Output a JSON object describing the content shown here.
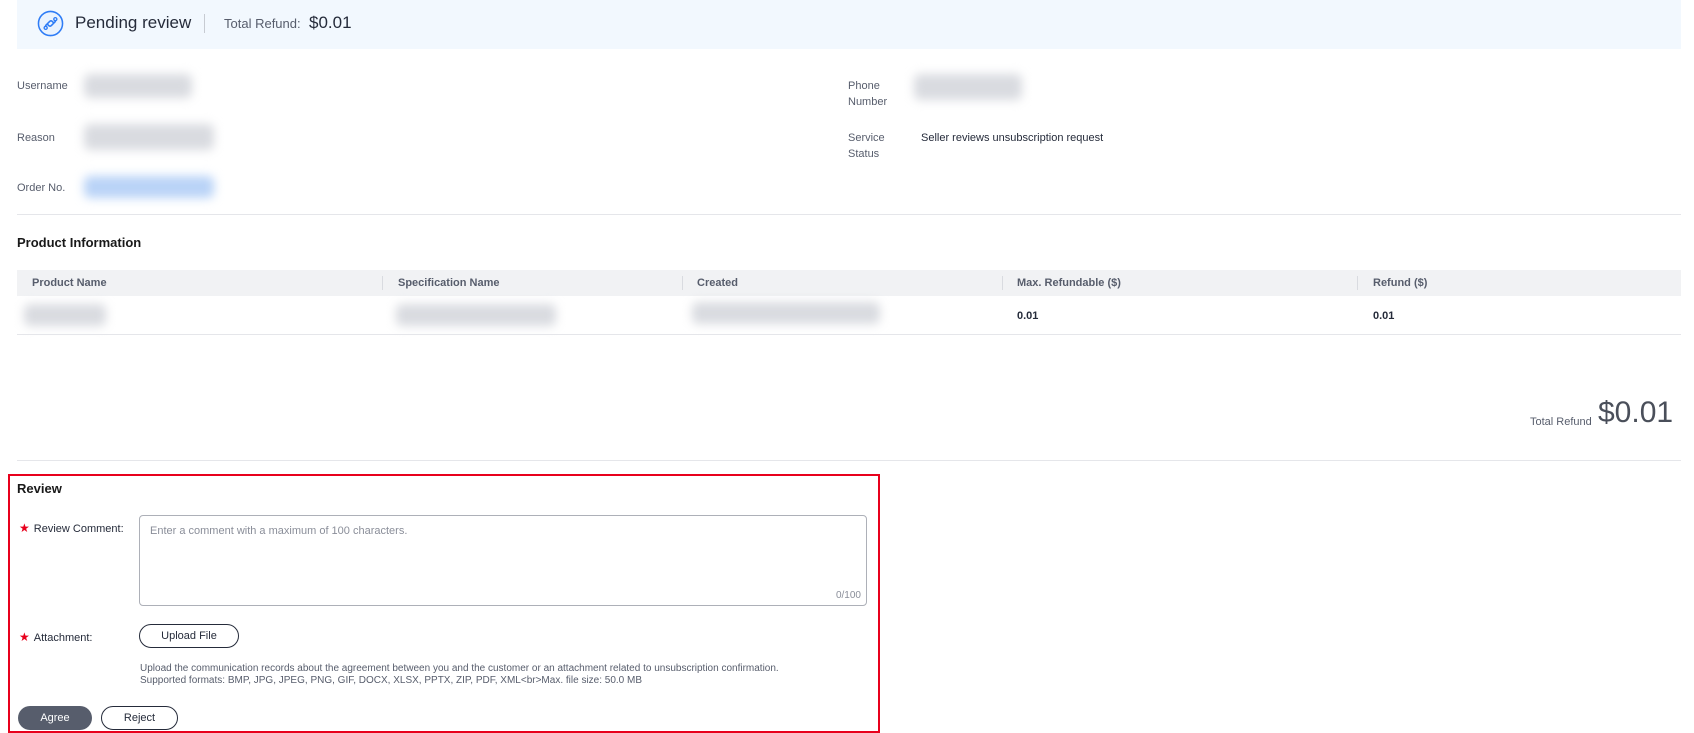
{
  "header": {
    "status": "Pending review",
    "refund_label": "Total Refund:",
    "refund_value": "$0.01"
  },
  "info": {
    "username_label": "Username",
    "phone_label_1": "Phone",
    "phone_label_2": "Number",
    "reason_label": "Reason",
    "service_label_1": "Service",
    "service_label_2": "Status",
    "service_value": "Seller reviews unsubscription request",
    "order_label": "Order No."
  },
  "product": {
    "title": "Product Information",
    "columns": [
      "Product Name",
      "Specification Name",
      "Created",
      "Max. Refundable ($)",
      "Refund ($)"
    ],
    "rows": [
      {
        "max_refundable": "0.01",
        "refund": "0.01"
      }
    ]
  },
  "totals": {
    "label": "Total Refund",
    "value": "$0.01"
  },
  "review": {
    "title": "Review",
    "comment_label": "Review Comment:",
    "comment_placeholder": "Enter a comment with a maximum of 100 characters.",
    "comment_counter": "0/100",
    "attachment_label": "Attachment:",
    "upload_button": "Upload File",
    "hint_line1": "Upload the communication records about the agreement between you and the customer or an attachment related to unsubscription confirmation.",
    "hint_line2": "Supported formats: BMP, JPG, JPEG, PNG, GIF, DOCX, XLSX, PPTX, ZIP, PDF, XML<br>Max. file size: 50.0 MB",
    "agree_button": "Agree",
    "reject_button": "Reject"
  }
}
